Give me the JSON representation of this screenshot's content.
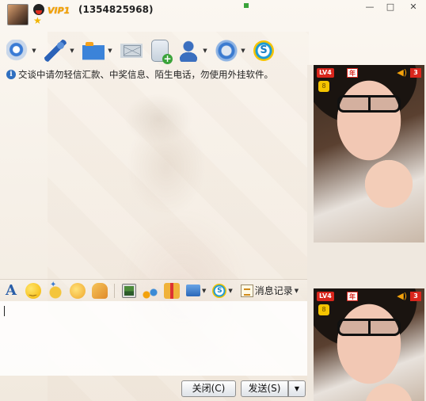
{
  "titlebar": {
    "vip_label": "VIP1",
    "qq_number": "(1354825968)",
    "minimize_label": "—",
    "maximize_label": "□",
    "close_label": "✕"
  },
  "toolbar": {
    "items": [
      {
        "name": "video-call",
        "icon": "webcam-icon",
        "has_menu": true
      },
      {
        "name": "voice-call",
        "icon": "microphone-icon",
        "has_menu": true
      },
      {
        "name": "send-file",
        "icon": "folder-send-icon",
        "has_menu": true
      },
      {
        "name": "send-mail",
        "icon": "mail-icon",
        "has_menu": false
      },
      {
        "name": "create-group",
        "icon": "document-add-icon",
        "has_menu": false
      },
      {
        "name": "contact-info",
        "icon": "contact-icon",
        "has_menu": true
      },
      {
        "name": "app-center",
        "icon": "app-icon",
        "has_menu": true
      },
      {
        "name": "soso",
        "icon": "s-logo-icon",
        "has_menu": false
      }
    ],
    "soso_label": "S"
  },
  "notice": {
    "info_label": "i",
    "text": "交谈中请勿轻信汇款、中奖信息、陌生电话，勿使用外挂软件。"
  },
  "format_bar": {
    "font_label": "A",
    "s_label": "S",
    "history_label": "消息记录",
    "caret": "▼"
  },
  "input": {
    "value": ""
  },
  "buttons": {
    "close_label": "关闭(C)",
    "send_label": "发送(S)",
    "send_menu_label": "▼"
  },
  "video": {
    "level_label": "LV4",
    "year_label": "年",
    "rank_label": "8",
    "count_label": "3",
    "speaker_label": "◀)"
  },
  "colors": {
    "accent_blue": "#2f6fc0",
    "vip_gold": "#f5a300",
    "badge_red": "#d9261c"
  }
}
